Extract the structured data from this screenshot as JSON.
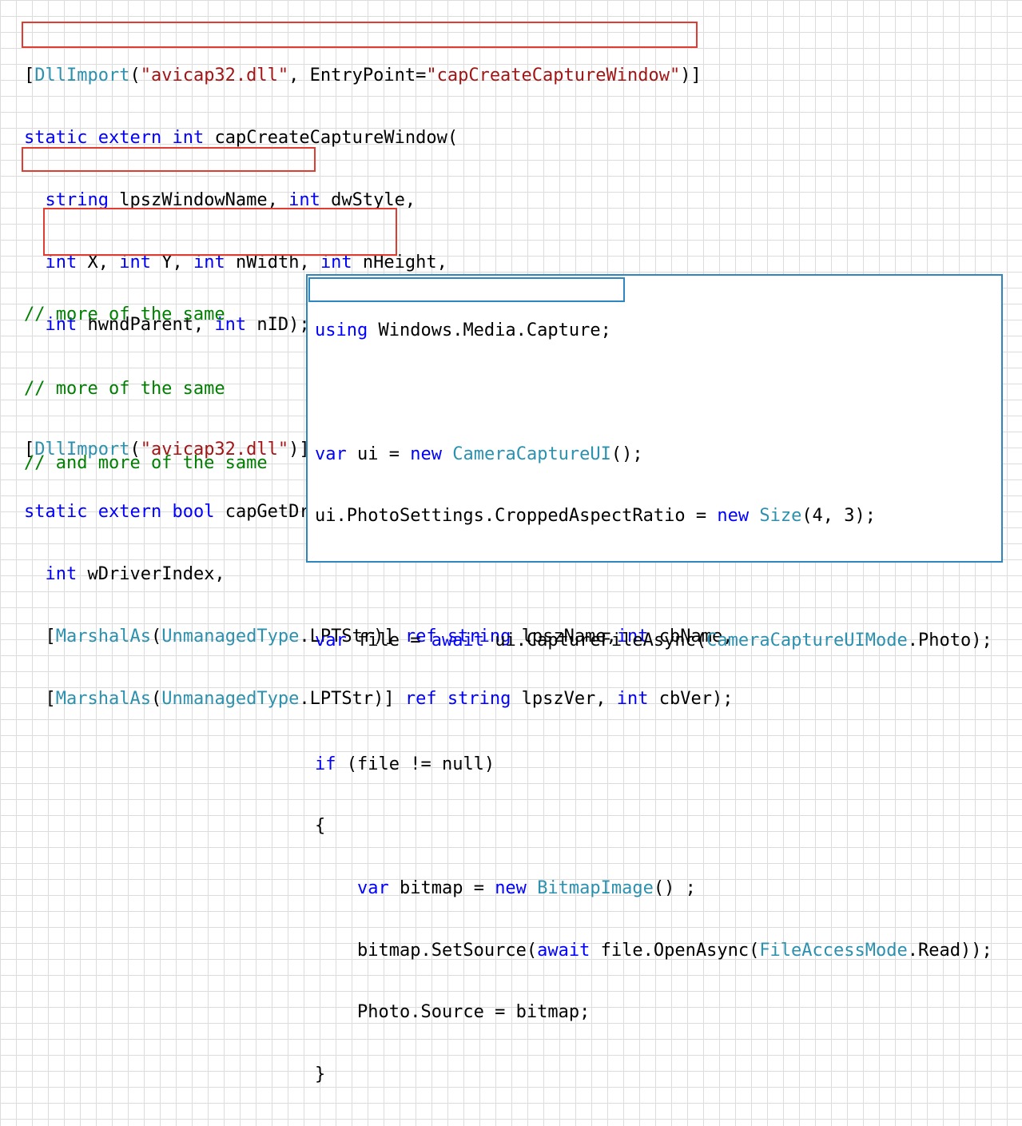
{
  "colors": {
    "keyword": "#0000ff",
    "type": "#2b91af",
    "string": "#a31515",
    "comment": "#008000",
    "highlight_red": "#e03c31",
    "highlight_blue": "#2e86c1"
  },
  "top_code": {
    "l1": [
      "[",
      "DllImport",
      "(",
      "\"avicap32.dll\"",
      ", EntryPoint=",
      "\"capCreateCaptureWindow\"",
      ")]"
    ],
    "l2": [
      "static",
      " ",
      "extern",
      " ",
      "int",
      " capCreateCaptureWindow("
    ],
    "l3": [
      "  ",
      "string",
      " lpszWindowName, ",
      "int",
      " dwStyle,"
    ],
    "l4": [
      "  ",
      "int",
      " X, ",
      "int",
      " Y, ",
      "int",
      " nWidth, ",
      "int",
      " nHeight,"
    ],
    "l5": [
      "  ",
      "int",
      " hwndParent, ",
      "int",
      " nID);"
    ],
    "l7": [
      "[",
      "DllImport",
      "(",
      "\"avicap32.dll\"",
      ")]"
    ],
    "l8": [
      "static",
      " ",
      "extern",
      " ",
      "bool",
      " capGetDriverDescription("
    ],
    "l9": [
      "  ",
      "int",
      " wDriverIndex,"
    ],
    "l10": [
      "  [",
      "MarshalAs",
      "(",
      "UnmanagedType",
      ".LPTStr)] ",
      "ref",
      " ",
      "string",
      " lpszName,",
      "int",
      " cbName,"
    ],
    "l11": [
      "  [",
      "MarshalAs",
      "(",
      "UnmanagedType",
      ".LPTStr)] ",
      "ref",
      " ",
      "string",
      " lpszVer, ",
      "int",
      " cbVer);"
    ]
  },
  "comments": [
    "// more of the same",
    "// more of the same",
    "// and more of the same"
  ],
  "bottom_code": {
    "l1": [
      "using",
      " Windows.Media.Capture;"
    ],
    "l3": [
      "var",
      " ui = ",
      "new",
      " ",
      "CameraCaptureUI",
      "();"
    ],
    "l4": [
      "ui.PhotoSettings.CroppedAspectRatio = ",
      "new",
      " ",
      "Size",
      "(4, 3);"
    ],
    "l6": [
      "var",
      " file = ",
      "await",
      " ui.CaptureFileAsync(",
      "CameraCaptureUIMode",
      ".Photo);"
    ],
    "l8": [
      "if",
      " (file != null)"
    ],
    "l9": [
      "{"
    ],
    "l10": [
      "    ",
      "var",
      " bitmap = ",
      "new",
      " ",
      "BitmapImage",
      "() ;"
    ],
    "l11": [
      "    bitmap.SetSource(",
      "await",
      " file.OpenAsync(",
      "FileAccessMode",
      ".Read));"
    ],
    "l12": [
      "    Photo.Source = bitmap;"
    ],
    "l13": [
      "}"
    ]
  }
}
